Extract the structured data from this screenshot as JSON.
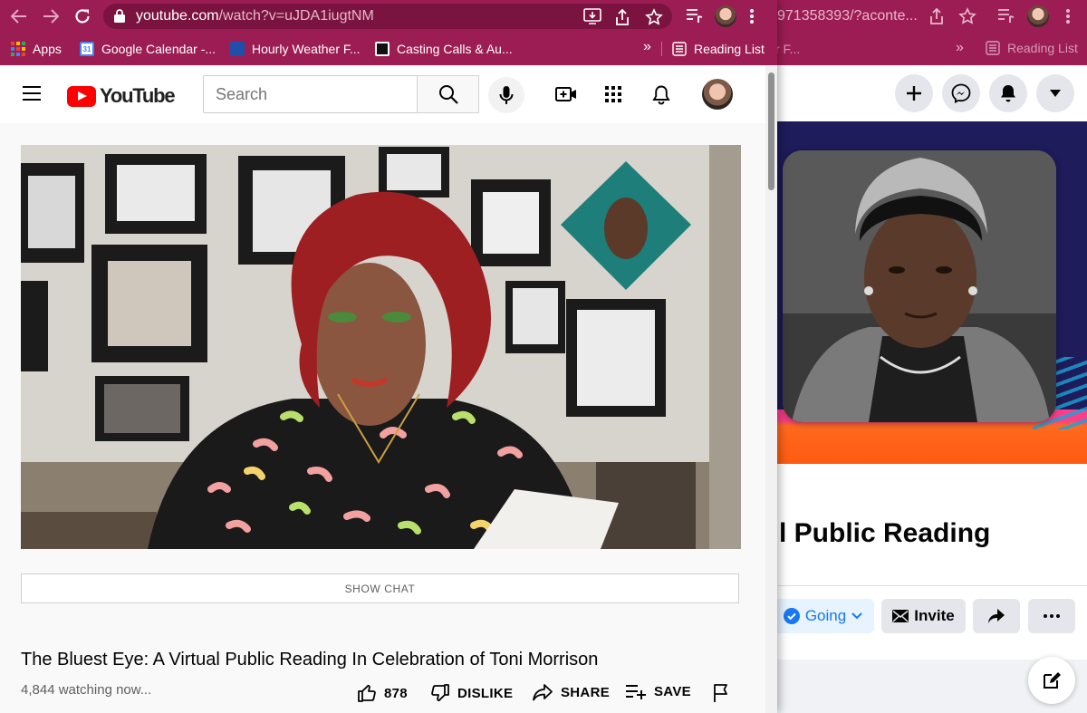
{
  "browser": {
    "url_host": "youtube.com",
    "url_path": "/watch?v=uJDA1iugtNM",
    "bookmarks": [
      {
        "label": "Apps",
        "icon": "apps-grid-icon"
      },
      {
        "label": "Google Calendar -...",
        "icon": "calendar-icon"
      },
      {
        "label": "Hourly Weather F...",
        "icon": "weather-channel-icon"
      },
      {
        "label": "Casting Calls & Au...",
        "icon": "casting-icon"
      }
    ],
    "overflow_label": "»",
    "reading_list": "Reading List",
    "accent": "#9c1d53"
  },
  "background_window": {
    "url_partial": "971358393/?aconte...",
    "bookmark_partial": "r F...",
    "overflow_label": "»",
    "reading_list": "Reading List",
    "event_title_partial": "l Public Reading",
    "going_label": "Going",
    "invite_label": "Invite"
  },
  "youtube": {
    "logo_text": "YouTube",
    "search_placeholder": "Search",
    "show_chat": "SHOW CHAT",
    "video_title": "The Bluest Eye: A Virtual Public Reading In Celebration of Toni Morrison",
    "watching": "4,844 watching now...",
    "actions": {
      "like_count": "878",
      "dislike": "DISLIKE",
      "share": "SHARE",
      "save": "SAVE"
    }
  }
}
